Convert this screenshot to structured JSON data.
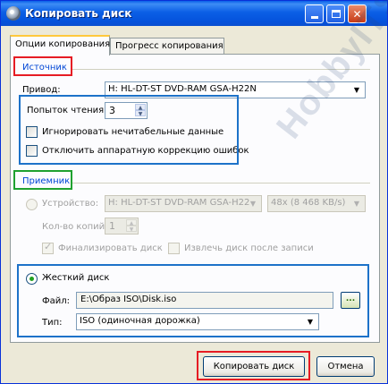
{
  "window": {
    "title": "Копировать диск"
  },
  "tabs": [
    {
      "label": "Опции копирования",
      "active": true
    },
    {
      "label": "Прогресс копирования",
      "active": false
    }
  ],
  "source": {
    "group_label": "Источник",
    "drive_label": "Привод:",
    "drive_value": "H: HL-DT-ST DVD-RAM GSA-H22N",
    "read_attempts_label": "Попыток чтения:",
    "read_attempts_value": "3",
    "ignore_unreadable_label": "Игнорировать нечитабельные данные",
    "ignore_unreadable_checked": false,
    "disable_hw_ecc_label": "Отключить аппаратную коррекцию ошибок",
    "disable_hw_ecc_checked": false
  },
  "destination": {
    "group_label": "Приемник",
    "device_label": "Устройство:",
    "device_value": "H: HL-DT-ST DVD-RAM GSA-H22",
    "speed_value": "48x (8 468 KB/s)",
    "copies_label": "Кол-во копий:",
    "copies_value": "1",
    "finalize_label": "Финализировать диск",
    "finalize_checked": true,
    "eject_label": "Извлечь диск после записи",
    "eject_checked": false,
    "hdd_label": "Жесткий диск",
    "hdd_selected": true,
    "file_label": "Файл:",
    "file_value": "E:\\Образ ISO\\Disk.iso",
    "browse_label": "...",
    "type_label": "Тип:",
    "type_value": "ISO (одиночная дорожка)"
  },
  "buttons": {
    "copy_label": "Копировать диск",
    "cancel_label": "Отмена"
  },
  "watermark": "HobbyITS.com",
  "colors": {
    "highlight_red": "#e61c24",
    "highlight_blue": "#1d72c9",
    "highlight_green": "#1fa12f",
    "titlebar": "#0553dc"
  }
}
